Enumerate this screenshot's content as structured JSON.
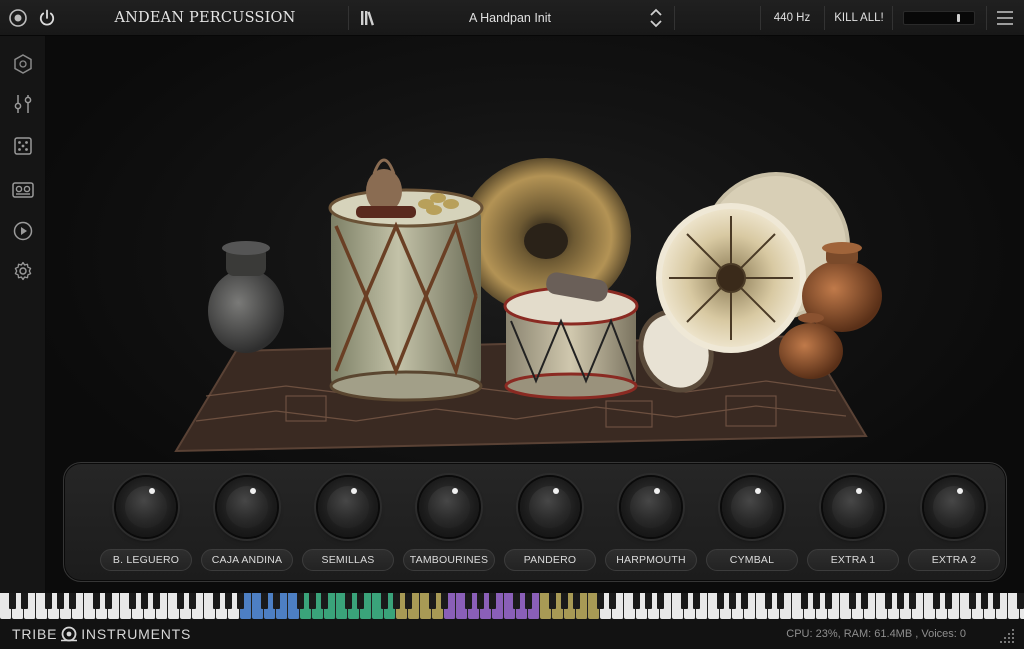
{
  "header": {
    "title": "ANDEAN PERCUSSION",
    "preset": "A Handpan Init",
    "tuning": "440 Hz",
    "kill_all": "KILL ALL!",
    "volume_level": 0.8
  },
  "sidebar": {
    "items": [
      {
        "icon": "hexagon-refresh-icon"
      },
      {
        "icon": "mixer-sliders-icon"
      },
      {
        "icon": "dice-icon"
      },
      {
        "icon": "tape-recorder-icon"
      },
      {
        "icon": "play-icon"
      },
      {
        "icon": "settings-gear-icon"
      }
    ]
  },
  "knobs": [
    {
      "label": "B. LEGUERO"
    },
    {
      "label": "CAJA ANDINA"
    },
    {
      "label": "SEMILLAS"
    },
    {
      "label": "TAMBOURINES"
    },
    {
      "label": "PANDERO"
    },
    {
      "label": "HARPMOUTH"
    },
    {
      "label": "CYMBAL"
    },
    {
      "label": "EXTRA 1"
    },
    {
      "label": "EXTRA 2"
    }
  ],
  "footer": {
    "brand_left": "TRIBE",
    "brand_right": "INSTRUMENTS",
    "status": "CPU: 23%, RAM: 61.4MB , Voices: 0"
  },
  "colors": {
    "accent_text": "#e0e0e0",
    "key_blue": "#4d7fc4",
    "key_purple": "#8a5fb8",
    "key_green": "#3aa37a",
    "key_gold": "#a89a55",
    "key_white": "#e8e8e8"
  }
}
